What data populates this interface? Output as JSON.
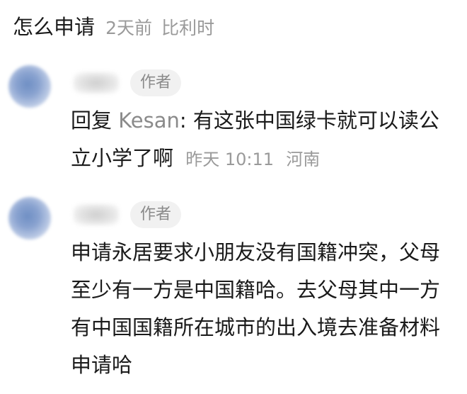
{
  "top_comment": {
    "text": "怎么申请",
    "time": "2天前",
    "location": "比利时"
  },
  "replies": [
    {
      "badge": "作者",
      "prefix": "回复",
      "mention": "Kesan",
      "text": ": 有这张中国绿卡就可以读公立小学了啊",
      "time": "昨天 10:11",
      "location": "河南"
    },
    {
      "badge": "作者",
      "text": "申请永居要求小朋友没有国籍冲突，父母至少有一方是中国籍哈。去父母其中一方有中国国籍所在城市的出入境去准备材料申请哈"
    }
  ]
}
